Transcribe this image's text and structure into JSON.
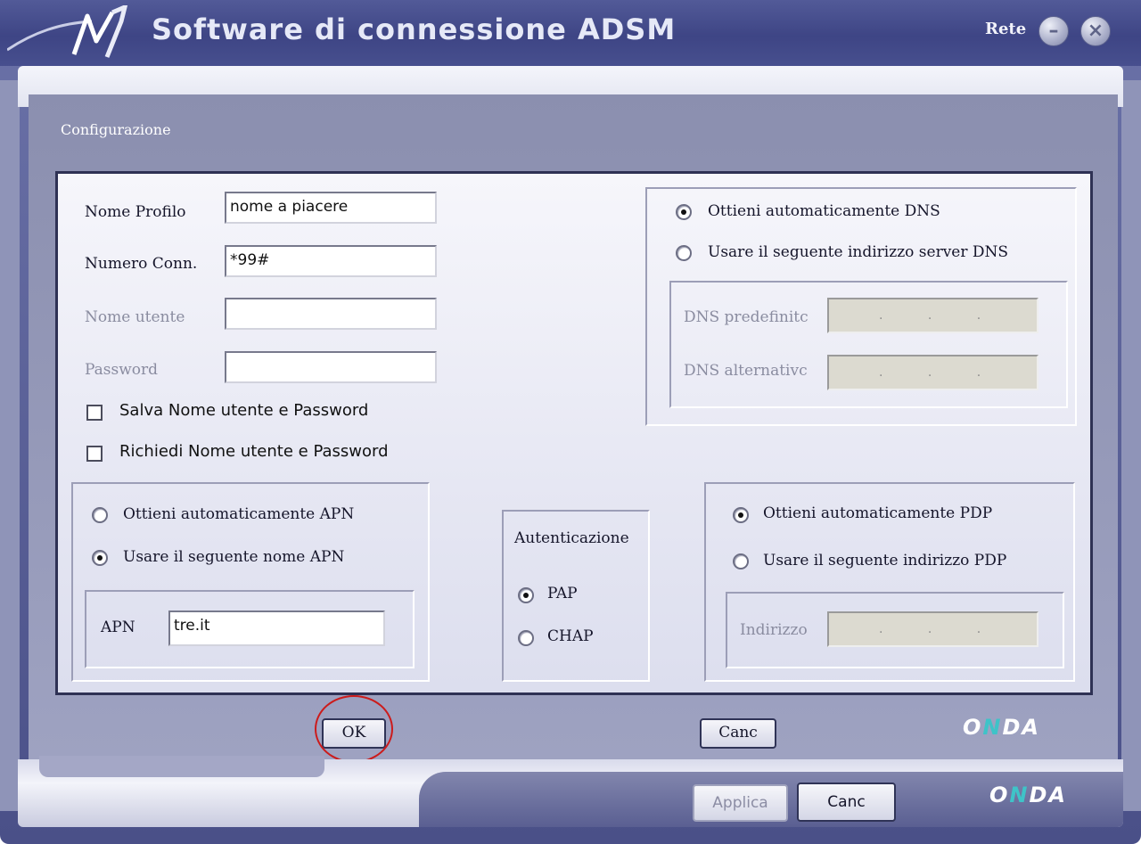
{
  "window": {
    "title": "Software di connessione ADSM",
    "network_label": "Rete",
    "minimize_glyph": "–",
    "close_glyph": "×"
  },
  "config": {
    "section_title": "Configurazione"
  },
  "profile": {
    "profile_name_label": "Nome Profilo",
    "profile_name_value": "nome a piacere",
    "conn_number_label": "Numero Conn.",
    "conn_number_value": "*99#",
    "username_label": "Nome utente",
    "username_value": "",
    "password_label": "Password",
    "password_value": "",
    "save_credentials_label": "Salva Nome utente e Password",
    "save_credentials_checked": false,
    "ask_credentials_label": "Richiedi Nome utente e Password",
    "ask_credentials_checked": false
  },
  "dns": {
    "auto_label": "Ottieni automaticamente DNS",
    "manual_label": "Usare il seguente indirizzo server DNS",
    "selected": "auto",
    "primary_label": "DNS predefinitc",
    "secondary_label": "DNS alternativc",
    "ip_placeholder": ". . ."
  },
  "apn": {
    "auto_label": "Ottieni automaticamente APN",
    "manual_label": "Usare il seguente nome APN",
    "selected": "manual",
    "apn_label": "APN",
    "apn_value": "tre.it"
  },
  "auth": {
    "title": "Autenticazione",
    "pap_label": "PAP",
    "chap_label": "CHAP",
    "selected": "PAP"
  },
  "pdp": {
    "auto_label": "Ottieni automaticamente PDP",
    "manual_label": "Usare il seguente indirizzo PDP",
    "selected": "auto",
    "address_label": "Indirizzo",
    "ip_placeholder": ". . ."
  },
  "buttons": {
    "ok": "OK",
    "cancel_inner": "Canc",
    "apply": "Applica",
    "cancel_outer": "Canc"
  },
  "brand": {
    "left": "O",
    "mid": "N",
    "right": "DA"
  },
  "colors": {
    "titlebar": "#3e4585",
    "panel": "#9ea2c1",
    "highlight_circle": "#cc1b1b",
    "brand_accent": "#3fc3c8"
  }
}
